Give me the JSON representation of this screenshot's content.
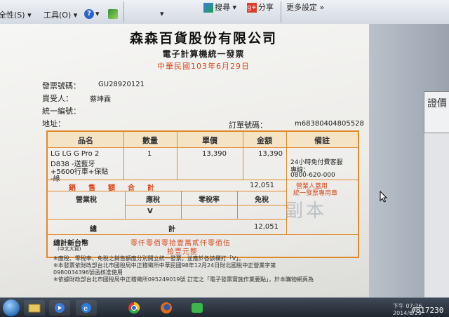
{
  "toolbar": {
    "page_menu": "全性(S)",
    "tools_menu": "工具(O)",
    "help_icon": "?",
    "search_btn": "搜尋",
    "share_btn": "分享",
    "more_settings": "更多設定",
    "more_arrow": "»"
  },
  "invoice": {
    "company": "森森百貨股份有限公司",
    "subtitle": "電子計算機統一發票",
    "date": "中華民國103年6月29日",
    "invoice_no_label": "發票號碼：",
    "invoice_no": "GU28920121",
    "buyer_label": "買受人：",
    "buyer": "蔡坤霖",
    "tax_id_label": "統一編號：",
    "address_label": "地址：",
    "order_no_label": "訂單號碼：",
    "order_no": "m68380404805528",
    "table": {
      "headers": [
        "品名",
        "數量",
        "單價",
        "金額",
        "備註"
      ],
      "item_name": [
        "LG LG G Pro 2",
        "D838 -送藍牙",
        "+5600行車+保貼",
        "-綠"
      ],
      "qty": "1",
      "unit_price": "13,390",
      "amount": "13,390",
      "remark_service": "24小時免付費客服",
      "remark_hotline_label": "專線：",
      "remark_hotline": "0800-620-000",
      "remark_seal": [
        "營業人蓋用",
        "統一發票專用章"
      ],
      "sales_label": "銷　售　額　合　計",
      "sales_total": "12,051",
      "tax_headers": [
        "營業稅",
        "應稅",
        "零稅率",
        "免稅"
      ],
      "taxable_mark": "V",
      "grand_label": "總　　　　　　　計",
      "grand_total": "12,051",
      "ntd_label": "總計新台幣",
      "ntd_sub": "(中文大寫)",
      "ntd_words_1": "零仟零佰零拾壹萬貳仟零佰伍",
      "ntd_words_2": "拾壹元整",
      "copy_stamp": "副本"
    },
    "notes": [
      "※應稅、零稅率、免稅之銷售額應分別開立統一發票，並應於各該欄打「V」。",
      "※本發票依財政部台北市國稅局中正稽徵所中華民國98年12月24日財北國稅中正營業字第",
      "  0980034396號函核准使用",
      "※依據財政部台北市國稅局中正稽徵所095249019號 訂定之「電子發票實施作業要點」，於本購物網頁為"
    ]
  },
  "side": {
    "card_text": "證價"
  },
  "taskbar": {
    "tray_time": "下午 07:26",
    "tray_date": "2014/6/29"
  },
  "watermark": "#817230",
  "colors": {
    "accent": "#e08a2a",
    "red_text": "#d6461a"
  }
}
